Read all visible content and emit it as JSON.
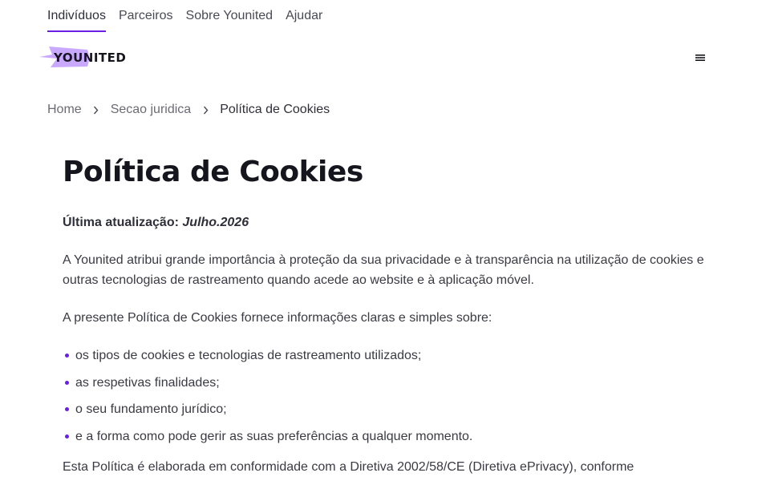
{
  "top_nav": {
    "items": [
      {
        "label": "Indivíduos",
        "active": true
      },
      {
        "label": "Parceiros",
        "active": false
      },
      {
        "label": "Sobre Younited",
        "active": false
      },
      {
        "label": "Ajudar",
        "active": false
      }
    ]
  },
  "header": {
    "logo_text": "YOUNITED",
    "menu_icon": "hamburger-menu-icon"
  },
  "breadcrumb": {
    "items": [
      "Home",
      "Secao juridica",
      "Política de Cookies"
    ],
    "separator_icon": "chevron-right-icon"
  },
  "content": {
    "title": "Política de Cookies",
    "updated_label": "Última atualização:",
    "updated_value": "Julho.2026",
    "paragraph_1": "A Younited atribui grande importância à proteção da sua privacidade e à transparência na utilização de cookies e outras tecnologias de rastreamento quando acede ao website e à aplicação móvel.",
    "paragraph_2": "A presente Política de Cookies fornece informações claras e simples sobre:",
    "bullets": [
      "os tipos de cookies e tecnologias de rastreamento utilizados;",
      "as respetivas finalidades;",
      "o seu fundamento jurídico;",
      "e a forma como pode gerir as suas preferências a qualquer momento."
    ],
    "paragraph_3": "Esta Política é elaborada em conformidade com a Diretiva 2002/58/CE (Diretiva ePrivacy), conforme"
  },
  "colors": {
    "accent": "#6a1ee6",
    "logo_shape": "#c9a8ff",
    "text_dark": "#15151d",
    "text_body": "#3a3a44"
  }
}
